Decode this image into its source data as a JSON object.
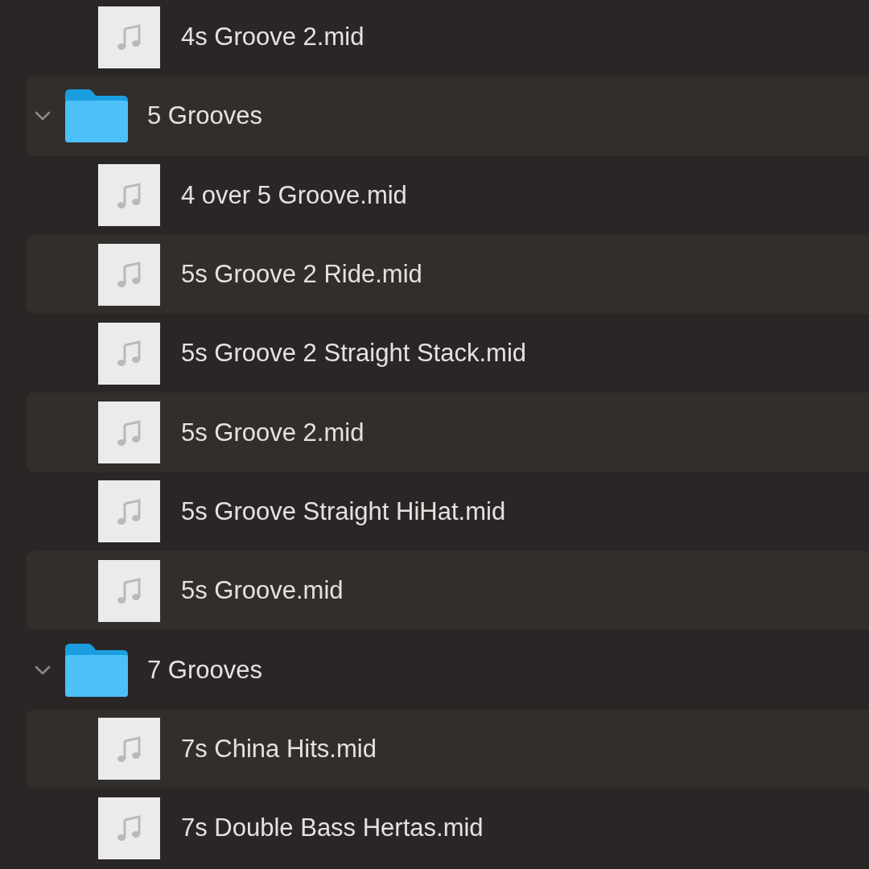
{
  "items": [
    {
      "kind": "file",
      "name": "4s Groove 2.mid"
    },
    {
      "kind": "folder",
      "name": "5 Grooves",
      "expanded": true,
      "children": [
        {
          "kind": "file",
          "name": "4 over 5 Groove.mid"
        },
        {
          "kind": "file",
          "name": "5s Groove 2 Ride.mid"
        },
        {
          "kind": "file",
          "name": "5s Groove 2 Straight Stack.mid"
        },
        {
          "kind": "file",
          "name": "5s Groove 2.mid"
        },
        {
          "kind": "file",
          "name": "5s Groove Straight HiHat.mid"
        },
        {
          "kind": "file",
          "name": "5s Groove.mid"
        }
      ]
    },
    {
      "kind": "folder",
      "name": "7 Grooves",
      "expanded": true,
      "children": [
        {
          "kind": "file",
          "name": "7s China Hits.mid"
        },
        {
          "kind": "file",
          "name": "7s Double Bass Hertas.mid"
        }
      ]
    }
  ]
}
